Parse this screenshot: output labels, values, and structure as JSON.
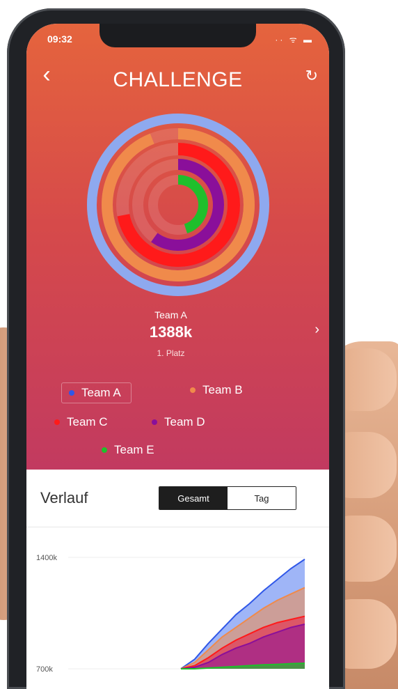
{
  "status": {
    "time": "09:32",
    "icons": "·· ᯤ ▬"
  },
  "header": {
    "back": "‹",
    "title": "CHALLENGE",
    "refresh": "↻"
  },
  "leader": {
    "name": "Team A",
    "score": "1388k",
    "rank": "1. Platz",
    "next": "›"
  },
  "teams": [
    {
      "name": "Team A",
      "color": "#2f57e8"
    },
    {
      "name": "Team B",
      "color": "#f08a4b"
    },
    {
      "name": "Team C",
      "color": "#ff1a1a"
    },
    {
      "name": "Team D",
      "color": "#8a0f9a"
    },
    {
      "name": "Team E",
      "color": "#1fbf2c"
    }
  ],
  "rings": [
    {
      "team": "Team A",
      "fraction": 1.0,
      "color": "#8ea9ef"
    },
    {
      "team": "Team B",
      "fraction": 0.94,
      "color": "#f08a4b"
    },
    {
      "team": "Team C",
      "fraction": 0.72,
      "color": "#ff1a1a"
    },
    {
      "team": "Team D",
      "fraction": 0.6,
      "color": "#8a0f9a"
    },
    {
      "team": "Team E",
      "fraction": 0.45,
      "color": "#1fbf2c"
    }
  ],
  "history": {
    "title": "Verlauf",
    "tabs": {
      "total": "Gesamt",
      "day": "Tag"
    }
  },
  "chart_data": {
    "type": "area",
    "ylim": [
      700,
      1400
    ],
    "yticks": [
      "1400k",
      "700k"
    ],
    "x": [
      0,
      1,
      2,
      3,
      4,
      5,
      6,
      7,
      8,
      9
    ],
    "series": [
      {
        "name": "Team A",
        "color": "#2f57e8",
        "values": [
          700,
          760,
          860,
          950,
          1040,
          1110,
          1190,
          1260,
          1330,
          1388
        ]
      },
      {
        "name": "Team B",
        "color": "#f08a4b",
        "values": [
          700,
          740,
          820,
          900,
          960,
          1020,
          1080,
          1130,
          1170,
          1210
        ]
      },
      {
        "name": "Team C",
        "color": "#ff1a1a",
        "values": [
          700,
          720,
          770,
          830,
          880,
          920,
          960,
          990,
          1010,
          1030
        ]
      },
      {
        "name": "Team D",
        "color": "#8a0f9a",
        "values": [
          700,
          710,
          740,
          790,
          830,
          860,
          900,
          930,
          960,
          980
        ]
      },
      {
        "name": "Team E",
        "color": "#1fbf2c",
        "values": [
          700,
          700,
          705,
          710,
          715,
          720,
          725,
          728,
          732,
          735
        ]
      }
    ]
  }
}
